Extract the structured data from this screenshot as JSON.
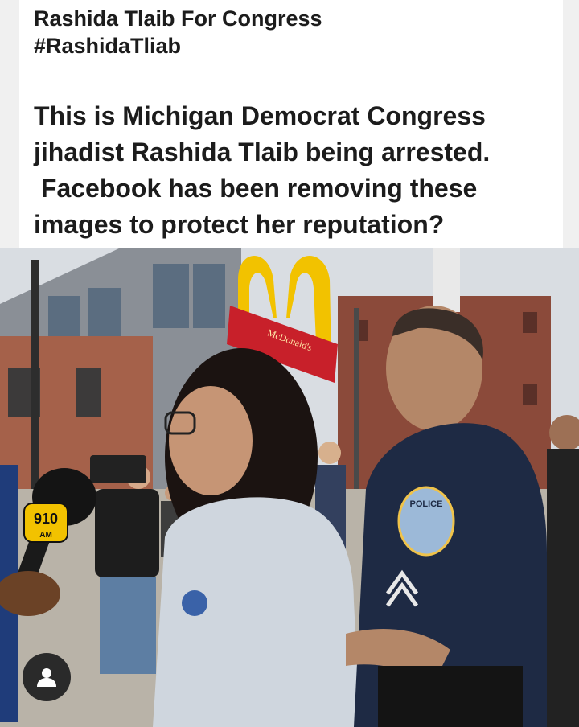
{
  "post": {
    "author_line1": "Rashida Tlaib For Congress",
    "author_line2": "#RashidaTliab",
    "body_lines": [
      "This is Michigan Democrat Congress",
      "jihadist Rashida Tlaib being arrested.",
      " Facebook has been removing these",
      "images to protect her reputation?"
    ]
  },
  "photo": {
    "mic_flag_number": "910",
    "mic_flag_sub": "AM",
    "sign_text": "McDonald's",
    "patch_text": "POLICE"
  },
  "overlay": {
    "user_icon": "user-avatar-icon"
  },
  "colors": {
    "post_background": "#ffffff",
    "text": "#1c1c1c",
    "arches_yellow": "#f2c200",
    "sign_red": "#c8202a",
    "police_navy": "#1e2a44"
  }
}
